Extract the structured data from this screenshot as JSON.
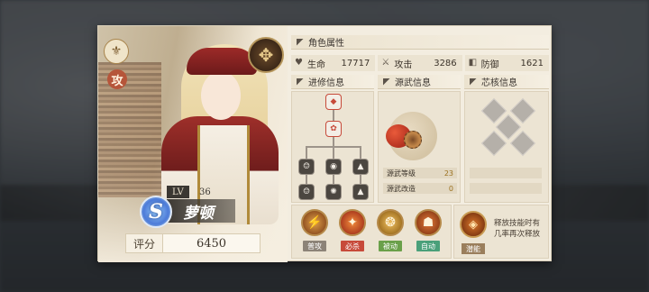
{
  "character": {
    "role_badge": "攻",
    "level_label": "LV",
    "level": "36",
    "rank": "S",
    "name": "萝顿",
    "score_label": "评分",
    "score": "6450"
  },
  "attributes": {
    "title": "角色属性",
    "stats": [
      {
        "icon": "heart-icon",
        "label": "生命",
        "value": "17717"
      },
      {
        "icon": "sword-icon",
        "label": "攻击",
        "value": "3286"
      },
      {
        "icon": "shield-icon",
        "label": "防御",
        "value": "1621"
      }
    ]
  },
  "advancement": {
    "title": "进修信息"
  },
  "weapon": {
    "title": "源武信息",
    "rows": [
      {
        "label": "源武等级",
        "value": "23"
      },
      {
        "label": "源武改造",
        "value": "0"
      }
    ]
  },
  "core": {
    "title": "芯核信息"
  },
  "skills": [
    {
      "label": "普攻",
      "color": "#8c8378",
      "icon_color": "#8a4a1c"
    },
    {
      "label": "必杀",
      "color": "#c74a3a",
      "icon_color": "#a5341c"
    },
    {
      "label": "被动",
      "color": "#6aa04a",
      "icon_color": "#9a6a1c"
    },
    {
      "label": "自动",
      "color": "#4aa07a",
      "icon_color": "#8a3a14"
    }
  ],
  "special_skill": {
    "label": "潜能",
    "description": "释放技能时有几率再次释放"
  },
  "colors": {
    "panel": "#f3ede0",
    "accent_red": "#c74a3a",
    "gold": "#b68a4a"
  }
}
